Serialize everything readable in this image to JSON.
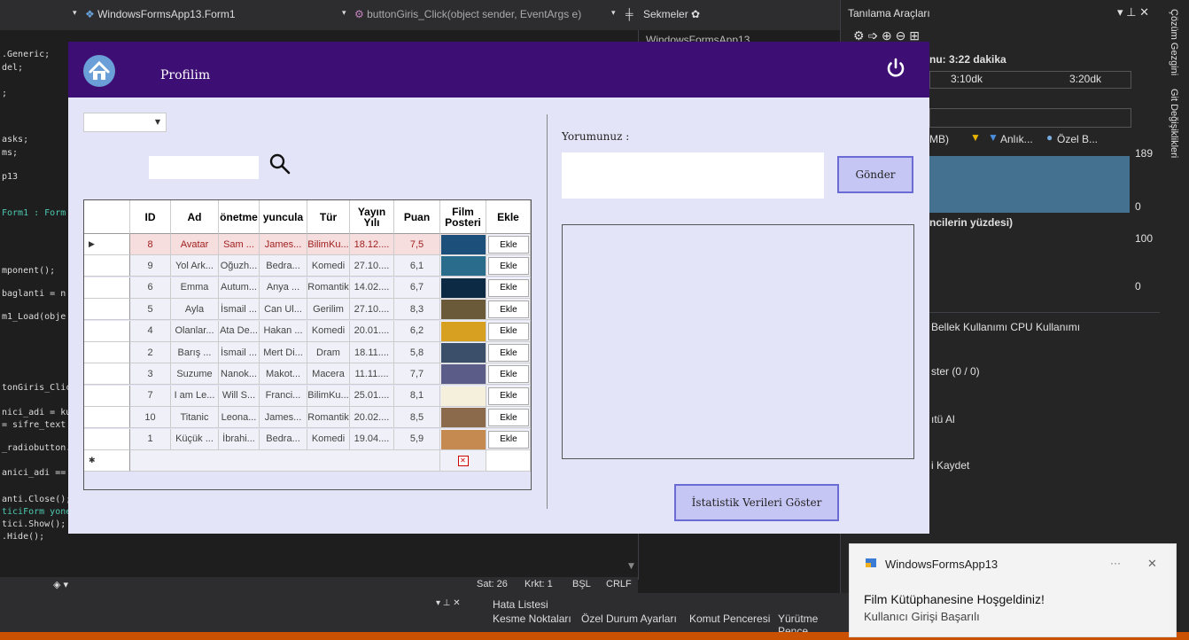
{
  "ide": {
    "class_dropdown": "WindowsFormsApp13.Form1",
    "method_dropdown": "buttonGiris_Click(object sender, EventArgs e)",
    "sekmeler": "Sekmeler",
    "solution_item": "WindowsFormsApp13",
    "code_lines": [
      ".Generic;",
      "del;",
      ";",
      "asks;",
      "ms;",
      "p13",
      "Form1 : Form",
      "mponent();",
      "baglanti = n",
      "m1_Load(obje",
      "tonGiris_Clic",
      "nici_adi = ku",
      " = sifre_text",
      "_radiobutton.",
      "anici_adi ==",
      "anti.Close();",
      "ticiForm yone",
      "tici.Show();",
      ".Hide();"
    ],
    "status": {
      "line": "Sat: 26",
      "col": "Krkt: 1",
      "mode": "BŞL",
      "eol": "CRLF"
    },
    "bottom_tab_title": "Hata Listesi",
    "bottom_tabs": [
      "Kesme Noktaları",
      "Özel Durum Ayarları",
      "Komut Penceresi",
      "Yürütme Pence"
    ],
    "right_vertical_1": "Çözüm Gezgini",
    "right_vertical_2": "Git Değişiklikleri",
    "diag": {
      "title": "Tanılama Araçları",
      "session": "nu: 3:22 dakika",
      "tick1": "3:10dk",
      "tick2": "3:20dk",
      "mem_legend": "MB)",
      "snapshot_legend": "Anlık...",
      "gc_legend": "Özel B...",
      "mem_max": "189",
      "mem_min": "0",
      "cpu_title": "ncilerin yüzdesi)",
      "cpu_max": "100",
      "cpu_min": "0",
      "tabs": "Bellek Kullanımı   CPU Kullanımı",
      "events": "ster (0 / 0)",
      "snapshot": "ıtü Al",
      "save": "i Kaydet"
    }
  },
  "form": {
    "title": "Profilim",
    "search_value": "",
    "grid": {
      "headers": [
        "ID",
        "Ad",
        "önetme",
        "yuncula",
        "Tür",
        "Yayın Yılı",
        "Puan",
        "Film Posteri",
        "Ekle"
      ],
      "rows": [
        [
          "8",
          "Avatar",
          "Sam ...",
          "James...",
          "BilimKu...",
          "18.12....",
          "7,5",
          "Ekle"
        ],
        [
          "9",
          "Yol Ark...",
          "Oğuzh...",
          "Bedra...",
          "Komedi",
          "27.10....",
          "6,1",
          "Ekle"
        ],
        [
          "6",
          "Emma",
          "Autum...",
          "Anya ...",
          "Romantik",
          "14.02....",
          "6,7",
          "Ekle"
        ],
        [
          "5",
          "Ayla",
          "İsmail ...",
          "Can Ul...",
          "Gerilim",
          "27.10....",
          "8,3",
          "Ekle"
        ],
        [
          "4",
          "Olanlar...",
          "Ata De...",
          "Hakan ...",
          "Komedi",
          "20.01....",
          "6,2",
          "Ekle"
        ],
        [
          "2",
          "Barış ...",
          "İsmail ...",
          "Mert Di...",
          "Dram",
          "18.11....",
          "5,8",
          "Ekle"
        ],
        [
          "3",
          "Suzume",
          "Nanok...",
          "Makot...",
          "Macera",
          "11.11....",
          "7,7",
          "Ekle"
        ],
        [
          "7",
          "I am Le...",
          "Will S...",
          "Franci...",
          "BilimKu...",
          "25.01....",
          "8,1",
          "Ekle"
        ],
        [
          "10",
          "Titanic",
          "Leona...",
          "James...",
          "Romantik",
          "20.02....",
          "8,5",
          "Ekle"
        ],
        [
          "1",
          "Küçük ...",
          "İbrahi...",
          "Bedra...",
          "Komedi",
          "19.04....",
          "5,9",
          "Ekle"
        ]
      ],
      "poster_colors": [
        "#1c4f7a",
        "#2a6c8c",
        "#0d2a44",
        "#6a5a3a",
        "#d8a020",
        "#3b4f6b",
        "#5c5c88",
        "#f5f0dc",
        "#8a6a4a",
        "#c48a50"
      ]
    },
    "comment_label": "Yorumunuz :",
    "send_button": "Gönder",
    "stats_button": "İstatistik Verileri Göster"
  },
  "toast": {
    "app": "WindowsFormsApp13",
    "more": "···",
    "close": "✕",
    "title": "Film Kütüphanesine Hoşgeldiniz!",
    "body": "Kullanıcı Girişi Başarılı"
  },
  "colors": {
    "form_header": "#3d0f74",
    "form_bg": "#e4e4f8",
    "button_bg": "#c6c6f5",
    "button_border": "#6b6bd6"
  }
}
